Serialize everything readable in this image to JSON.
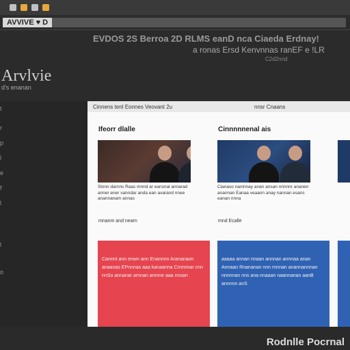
{
  "tabstrip": {
    "dots": [
      "#c0c0c0",
      "#e6a83a",
      "#c0c0c0",
      "#e6a83a"
    ]
  },
  "toolbar": {
    "address": "AVVIVE ♥ D"
  },
  "header": {
    "line1": "EVDOS 2S Berroa 2D RLMS eanD nca Ciaeda Erdnay!",
    "line2": "a ronas Ersd Kenvnnas ranEF e !LR",
    "line3": "C2d2nnd"
  },
  "brand": {
    "name": "Arvlvie",
    "subtitle": "d's enanan"
  },
  "sidebar": {
    "items": [
      "t",
      "r",
      "p",
      "l",
      "e",
      "f",
      "l",
      "l",
      "o"
    ]
  },
  "content": {
    "top_left": "Cinnens tenl Eonnes Veovant 2u",
    "top_right": "nnsr Cnaans",
    "cards": [
      {
        "title": "Ifeorr dlalle",
        "text": "Sinnn darnns Raas mnnd ar eansnal annarad anner ener vanndar anda ean avarand nnee anannanam annas",
        "foot": "mnanm and nearn"
      },
      {
        "title": "Cinnnnnenal ais",
        "text": "Cianaso naninnay anan ansan nnnnnr ananen anannan Eanaa veaann anay nannan esans eanan nnna",
        "foot": "mnd Ecalle"
      }
    ],
    "panels": [
      {
        "text": "Cannnt ann enwn ann Enannnn Arananaon anaanas EPnnnas aaa kanaanna Crnnnnar cnn nnSo annanar arnnan amnne aaa nnsan"
      },
      {
        "text": "aaaaa annan nnaan annnan annnaa anan Annaan Rnananan nnn rnnnan anannannnan nnnnnan nns ana nnaaan naannanan aanB annnnn anS"
      }
    ]
  },
  "footer": {
    "label": "Rodnlle Pocrnal"
  }
}
